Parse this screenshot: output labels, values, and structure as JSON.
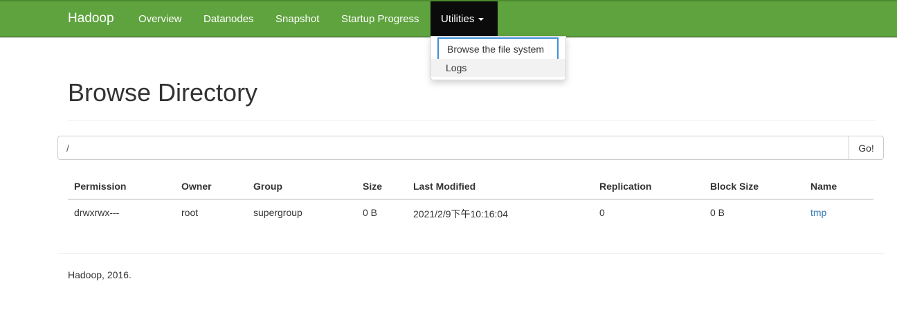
{
  "navbar": {
    "brand": "Hadoop",
    "items": [
      {
        "label": "Overview"
      },
      {
        "label": "Datanodes"
      },
      {
        "label": "Snapshot"
      },
      {
        "label": "Startup Progress"
      },
      {
        "label": "Utilities"
      }
    ],
    "active_item": "Utilities",
    "colors": {
      "background": "#5fa33e",
      "active": "#0b0b0b"
    }
  },
  "dropdown": {
    "items": [
      {
        "label": "Browse the file system"
      },
      {
        "label": "Logs"
      }
    ],
    "focused_item": "Browse the file system",
    "focus_color": "#3e8fd6"
  },
  "page": {
    "title": "Browse Directory"
  },
  "search": {
    "value": "/",
    "button_label": "Go!"
  },
  "table": {
    "headers": [
      "Permission",
      "Owner",
      "Group",
      "Size",
      "Last Modified",
      "Replication",
      "Block Size",
      "Name"
    ],
    "rows": [
      {
        "permission": "drwxrwx---",
        "owner": "root",
        "group": "supergroup",
        "size": "0 B",
        "last_modified": "2021/2/9下午10:16:04",
        "replication": "0",
        "block_size": "0 B",
        "name": "tmp"
      }
    ],
    "link_color": "#337ab7"
  },
  "footer": {
    "text": "Hadoop, 2016."
  }
}
